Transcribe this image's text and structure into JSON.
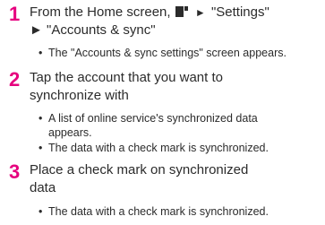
{
  "steps": [
    {
      "number": "1",
      "line1_prefix": "From the Home screen,",
      "icon": "menu-key-icon",
      "arrow": "►",
      "line1_suffix": "\"Settings\"",
      "line2": "► \"Accounts & sync\"",
      "bullets": [
        {
          "text": "The \"Accounts & sync settings\" screen appears."
        }
      ]
    },
    {
      "number": "2",
      "line1": "Tap the account that you want to",
      "line2": "synchronize with",
      "bullets": [
        {
          "text": "A list of online service's synchronized data",
          "cont": "appears."
        },
        {
          "text": "The data with a check mark is synchronized."
        }
      ]
    },
    {
      "number": "3",
      "line1": "Place a check mark on synchronized",
      "line2": "data",
      "bullets": [
        {
          "text": "The data with a check mark is synchronized."
        }
      ]
    }
  ],
  "bullet_char": "•",
  "colors": {
    "step_number": "#e6007e",
    "text": "#2b2b2b"
  }
}
